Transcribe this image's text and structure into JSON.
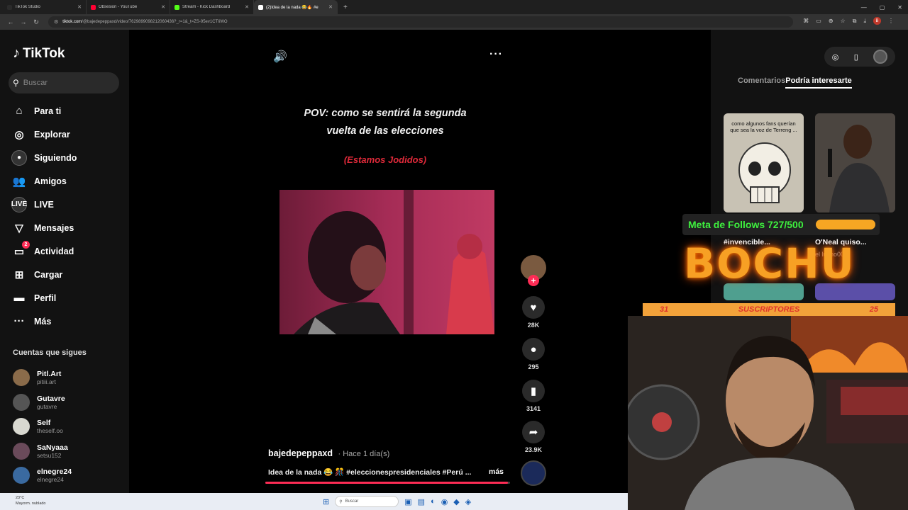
{
  "browser": {
    "tabs": [
      {
        "title": "TikTok Studio",
        "color": "#2b2b2b",
        "active": false
      },
      {
        "title": "Obsesion - YouTube",
        "color": "#ff0033",
        "active": false
      },
      {
        "title": "Stream - Kick Dashboard",
        "color": "#53fc18",
        "active": false
      },
      {
        "title": "(2)Idea de la nada 😂🔥 #e",
        "color": "#ffffff",
        "active": true
      }
    ],
    "url_domain": "tiktok.com",
    "url_path": "/@bajedepeppaxd/video/7629899098212060436?_r=1&_t=ZS-95ev1CTIiWO",
    "profile_initial": "B"
  },
  "sidebar": {
    "logo": "TikTok",
    "search_placeholder": "Buscar",
    "menu": [
      {
        "label": "Para ti",
        "icon": "home-icon",
        "glyph": "⌂"
      },
      {
        "label": "Explorar",
        "icon": "compass-icon",
        "glyph": "◎"
      },
      {
        "label": "Siguiendo",
        "icon": "following-avatar-icon",
        "glyph": "●"
      },
      {
        "label": "Amigos",
        "icon": "friends-icon",
        "glyph": "👥"
      },
      {
        "label": "LIVE",
        "icon": "live-icon",
        "glyph": "LIVE"
      },
      {
        "label": "Mensajes",
        "icon": "send-icon",
        "glyph": "▽"
      },
      {
        "label": "Actividad",
        "icon": "activity-icon",
        "glyph": "▭",
        "badge": "2"
      },
      {
        "label": "Cargar",
        "icon": "upload-icon",
        "glyph": "⊞"
      },
      {
        "label": "Perfil",
        "icon": "profile-avatar-icon",
        "glyph": "▬"
      },
      {
        "label": "Más",
        "icon": "more-icon",
        "glyph": "···"
      }
    ],
    "following_title": "Cuentas que sigues",
    "following": [
      {
        "name": "Pitl.Art",
        "handle": "pitiii.art",
        "color": "#8a6b4a"
      },
      {
        "name": "Gutavre",
        "handle": "gutavre",
        "color": "#555555"
      },
      {
        "name": "Self",
        "handle": "theself.oo",
        "color": "#d8d8d0"
      },
      {
        "name": "SaNyaaa",
        "handle": "setsu152",
        "color": "#6a4a5a"
      },
      {
        "name": "elnegre24",
        "handle": "elnegre24",
        "color": "#3a6aa0"
      }
    ]
  },
  "video": {
    "caption_line1": "POV: como se sentirá la segunda",
    "caption_line2": "vuelta de las elecciones",
    "caption_red": "(Estamos Jodidos)",
    "creator": "bajedepeppaxd",
    "posted": "· Hace 1 día(s)",
    "description": "Idea de la nada 😂 🎊 #eleccionespresidenciales #Perú ...",
    "more_label": "más",
    "progress": 0.99,
    "likes": "28K",
    "comments": "295",
    "saves": "3141",
    "shares": "23.9K"
  },
  "right_panel": {
    "tab_comments": "Comentarios",
    "tab_recommended": "Podría interesarte",
    "thumb1_caption": "como algunos fans querían que sea la voz de Terreng ...",
    "thumb1_title": "#invencible...",
    "thumb2_title": "O'Neal quiso...",
    "thumb2_sub": "el lucho005"
  },
  "overlay": {
    "goal_text": "Meta de Follows 727/500",
    "brand": "BOCHU",
    "subs_left": "31",
    "subs_label": "SUSCRIPTORES",
    "subs_right": "25"
  },
  "taskbar": {
    "temp": "23°C",
    "weather": "Mayorm. nublado",
    "search": "Buscar"
  }
}
